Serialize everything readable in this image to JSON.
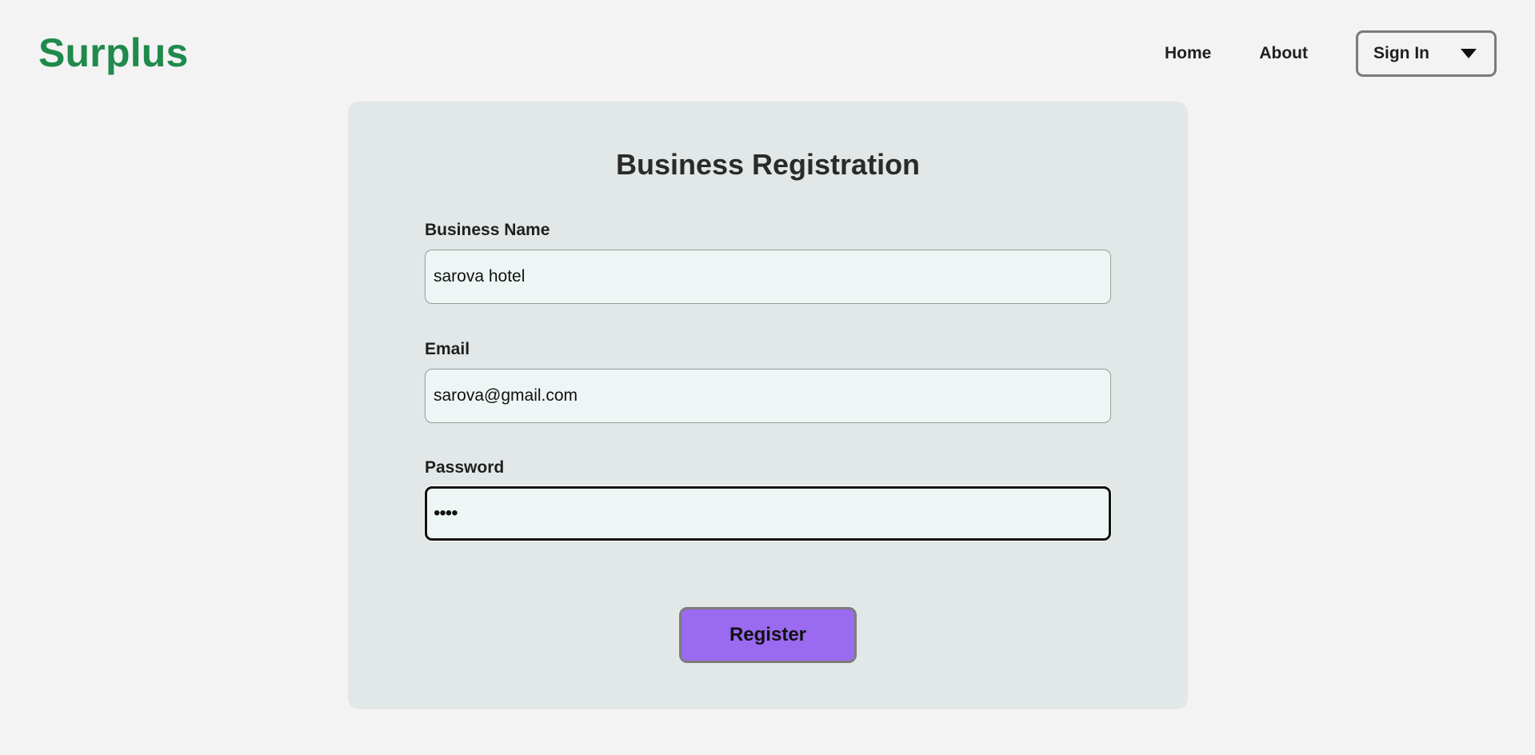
{
  "header": {
    "logo": "Surplus",
    "nav": {
      "home": "Home",
      "about": "About",
      "sign_in": "Sign In"
    }
  },
  "form": {
    "title": "Business Registration",
    "business_name": {
      "label": "Business Name",
      "value": "sarova hotel"
    },
    "email": {
      "label": "Email",
      "value": "sarova@gmail.com"
    },
    "password": {
      "label": "Password",
      "value": "••••"
    },
    "register_label": "Register"
  },
  "colors": {
    "brand": "#1f8a4c",
    "register_button": "#9a6af0"
  },
  "icons": {
    "sign_in_dropdown": "chevron-down-icon"
  }
}
